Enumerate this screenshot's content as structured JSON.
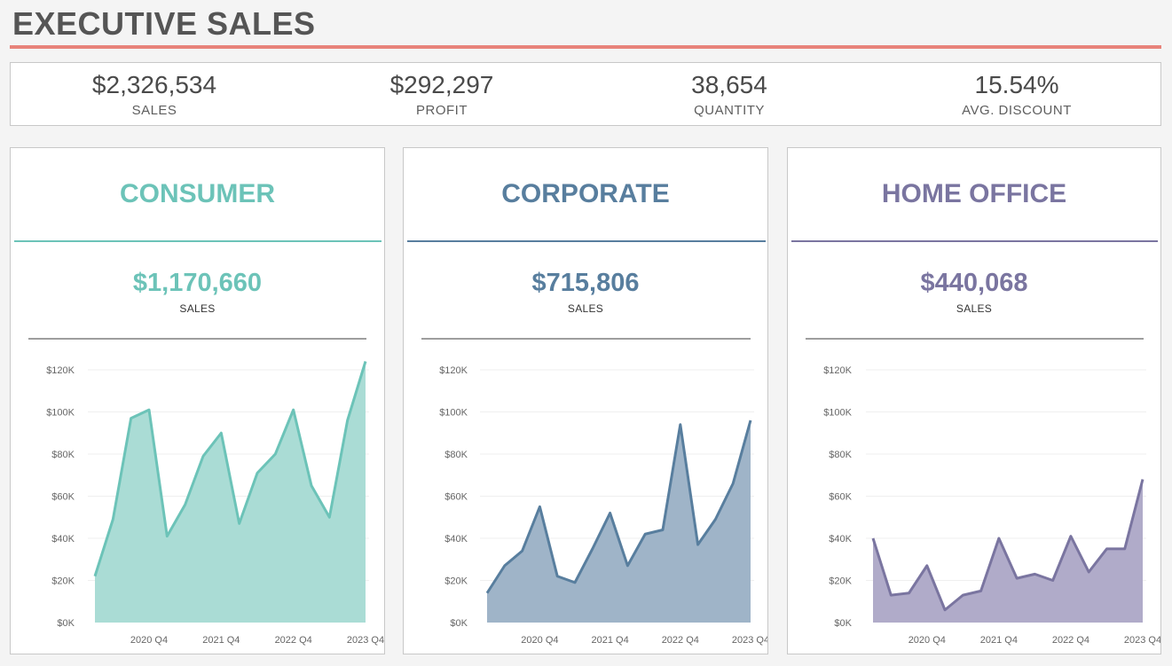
{
  "header": {
    "title": "EXECUTIVE SALES"
  },
  "kpis": [
    {
      "value": "$2,326,534",
      "label": "SALES"
    },
    {
      "value": "$292,297",
      "label": "PROFIT"
    },
    {
      "value": "38,654",
      "label": "QUANTITY"
    },
    {
      "value": "15.54%",
      "label": "AVG. DISCOUNT"
    }
  ],
  "segments": [
    {
      "title": "CONSUMER",
      "value": "$1,170,660",
      "label": "SALES",
      "color": "#6cc3b8",
      "fill": "#a5dad3"
    },
    {
      "title": "CORPORATE",
      "value": "$715,806",
      "label": "SALES",
      "color": "#587e9e",
      "fill": "#9ab0c5"
    },
    {
      "title": "HOME OFFICE",
      "value": "$440,068",
      "label": "SALES",
      "color": "#7a75a0",
      "fill": "#aca7c6"
    }
  ],
  "chart_data": [
    {
      "type": "area",
      "title": "CONSUMER",
      "x": [
        "2020 Q1",
        "2020 Q2",
        "2020 Q3",
        "2020 Q4",
        "2021 Q1",
        "2021 Q2",
        "2021 Q3",
        "2021 Q4",
        "2022 Q1",
        "2022 Q2",
        "2022 Q3",
        "2022 Q4",
        "2023 Q1",
        "2023 Q2",
        "2023 Q3",
        "2023 Q4"
      ],
      "x_ticks": [
        "2020 Q4",
        "2021 Q4",
        "2022 Q4",
        "2023 Q4"
      ],
      "y_ticks": [
        "$0K",
        "$20K",
        "$40K",
        "$60K",
        "$80K",
        "$100K",
        "$120K"
      ],
      "ylim": [
        0,
        120000
      ],
      "series": [
        {
          "values": [
            22000,
            49000,
            97000,
            101000,
            41000,
            56000,
            79000,
            90000,
            47000,
            71000,
            80000,
            101000,
            65000,
            50000,
            96000,
            124000
          ]
        }
      ]
    },
    {
      "type": "area",
      "title": "CORPORATE",
      "x": [
        "2020 Q1",
        "2020 Q2",
        "2020 Q3",
        "2020 Q4",
        "2021 Q1",
        "2021 Q2",
        "2021 Q3",
        "2021 Q4",
        "2022 Q1",
        "2022 Q2",
        "2022 Q3",
        "2022 Q4",
        "2023 Q1",
        "2023 Q2",
        "2023 Q3",
        "2023 Q4"
      ],
      "x_ticks": [
        "2020 Q4",
        "2021 Q4",
        "2022 Q4",
        "2023 Q4"
      ],
      "y_ticks": [
        "$0K",
        "$20K",
        "$40K",
        "$60K",
        "$80K",
        "$100K",
        "$120K"
      ],
      "ylim": [
        0,
        120000
      ],
      "series": [
        {
          "values": [
            14000,
            27000,
            34000,
            55000,
            22000,
            19000,
            35000,
            52000,
            27000,
            42000,
            44000,
            94000,
            37000,
            49000,
            66000,
            96000
          ]
        }
      ]
    },
    {
      "type": "area",
      "title": "HOME OFFICE",
      "x": [
        "2020 Q1",
        "2020 Q2",
        "2020 Q3",
        "2020 Q4",
        "2021 Q1",
        "2021 Q2",
        "2021 Q3",
        "2021 Q4",
        "2022 Q1",
        "2022 Q2",
        "2022 Q3",
        "2022 Q4",
        "2023 Q1",
        "2023 Q2",
        "2023 Q3",
        "2023 Q4"
      ],
      "x_ticks": [
        "2020 Q4",
        "2021 Q4",
        "2022 Q4",
        "2023 Q4"
      ],
      "y_ticks": [
        "$0K",
        "$20K",
        "$40K",
        "$60K",
        "$80K",
        "$100K",
        "$120K"
      ],
      "ylim": [
        0,
        120000
      ],
      "series": [
        {
          "values": [
            40000,
            13000,
            14000,
            27000,
            6000,
            13000,
            15000,
            40000,
            21000,
            23000,
            20000,
            41000,
            24000,
            35000,
            35000,
            68000
          ]
        }
      ]
    }
  ]
}
